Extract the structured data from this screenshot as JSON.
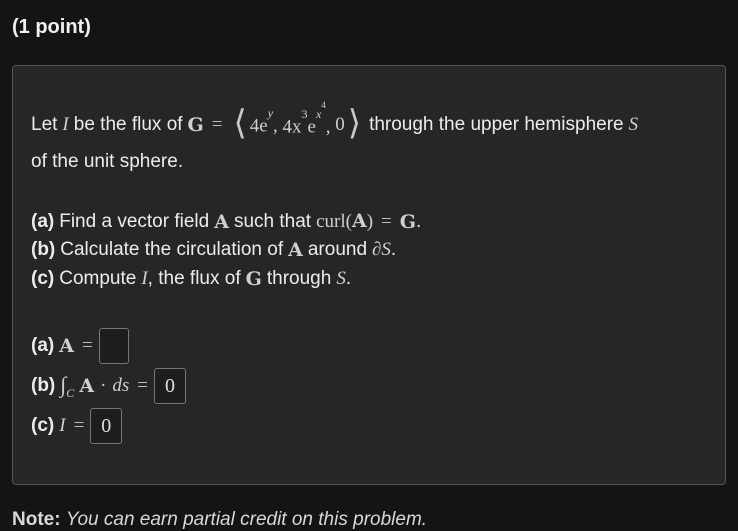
{
  "header": {
    "points": "(1 point)"
  },
  "problem": {
    "intro_prefix": "Let",
    "intro_symbol_I": "I",
    "intro_mid": "be the flux of",
    "G": "G",
    "equals": "=",
    "vector_first": "4e",
    "vector_first_exp": "y",
    "vector_second": "4x",
    "vector_second_exp": "3",
    "vector_second_e": "e",
    "vector_second_e_exp": "x",
    "vector_second_e_exp_exp": "4",
    "vector_third": "0",
    "intro_suffix": "through the upper hemisphere",
    "S": "S",
    "line2": "of the unit sphere.",
    "part_a_label": "(a)",
    "part_a_text": "Find a vector field",
    "A": "A",
    "part_a_mid": "such that",
    "curl": "curl",
    "part_b_label": "(b)",
    "part_b_text": "Calculate the circulation of",
    "part_b_mid": "around",
    "partial": "∂",
    "part_c_label": "(c)",
    "part_c_text": "Compute",
    "part_c_mid": ", the flux of",
    "part_c_suffix": "through"
  },
  "answers": {
    "a_label": "(a)",
    "a_value": "",
    "b_label": "(b)",
    "b_integral": "∫",
    "b_sub": "C",
    "b_dot": "·",
    "b_ds": "ds",
    "b_value": "0",
    "c_label": "(c)",
    "c_value": "0"
  },
  "footer": {
    "note_label": "Note:",
    "note_text": "You can earn partial credit on this problem."
  }
}
